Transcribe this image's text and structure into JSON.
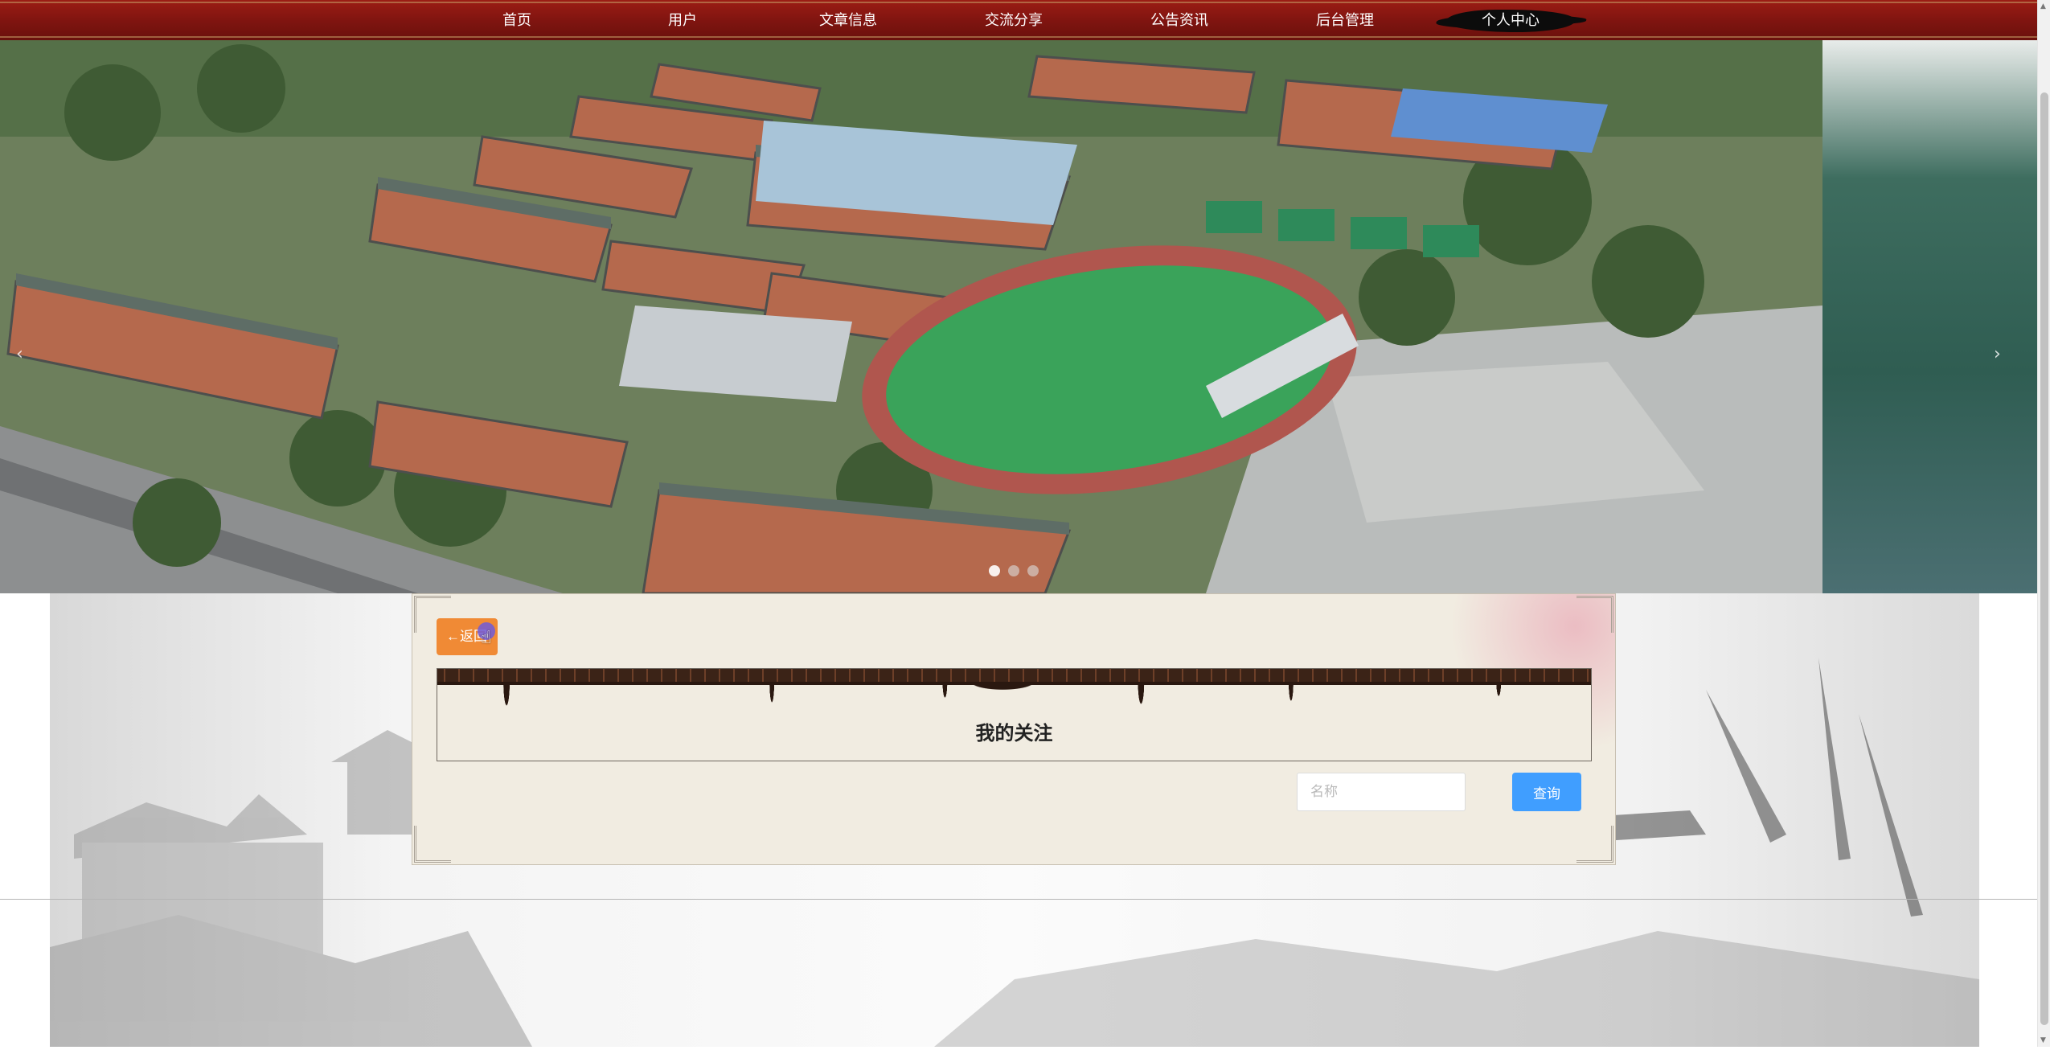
{
  "nav": {
    "items": [
      {
        "label": "首页"
      },
      {
        "label": "用户"
      },
      {
        "label": "文章信息"
      },
      {
        "label": "交流分享"
      },
      {
        "label": "公告资讯"
      },
      {
        "label": "后台管理"
      },
      {
        "label": "个人中心",
        "active": true
      }
    ]
  },
  "banner": {
    "slide_count": 3,
    "current_slide": 1
  },
  "panel": {
    "back_label": "←返回",
    "title": "我的关注",
    "search_placeholder": "名称",
    "search_value": "",
    "search_button": "查询"
  },
  "colors": {
    "nav_bg": "#7e1410",
    "back_button": "#f08a35",
    "search_button": "#409eff",
    "panel_bg": "#f1ece1"
  },
  "icons": [
    "hand-pointer-icon",
    "arrow-left-icon",
    "chevron-left-icon",
    "chevron-right-icon"
  ]
}
